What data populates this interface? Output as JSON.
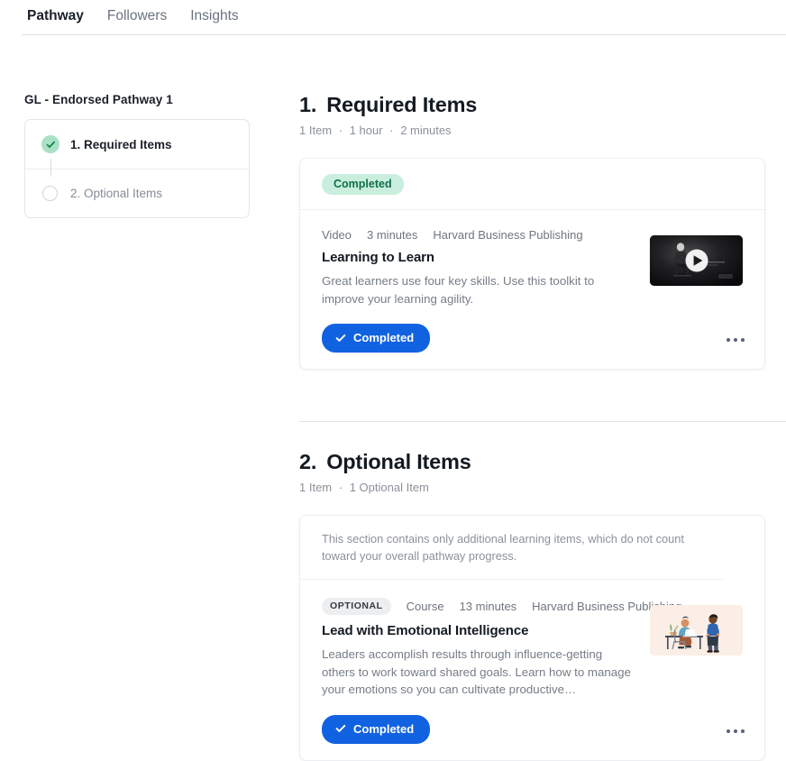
{
  "tabs": [
    {
      "label": "Pathway",
      "active": true
    },
    {
      "label": "Followers",
      "active": false
    },
    {
      "label": "Insights",
      "active": false
    }
  ],
  "sidebar": {
    "title": "GL - Endorsed Pathway 1",
    "items": [
      {
        "label": "1. Required Items",
        "state": "completed"
      },
      {
        "label": "2. Optional Items",
        "state": "todo"
      }
    ]
  },
  "sections": [
    {
      "number": "1.",
      "title": "Required Items",
      "meta": [
        "1 Item",
        "1 hour",
        "2 minutes"
      ],
      "banner_badge": "Completed",
      "note": null,
      "item": {
        "badge": null,
        "type": "Video",
        "duration": "3 minutes",
        "provider": "Harvard Business Publishing",
        "title": "Learning to Learn",
        "description": "Great learners use four key skills. Use this toolkit to improve your learning agility.",
        "button_label": "Completed",
        "thumbnail": "video-thumbnail"
      }
    },
    {
      "number": "2.",
      "title": "Optional Items",
      "meta": [
        "1 Item",
        "1 Optional Item"
      ],
      "banner_badge": null,
      "note": "This section contains only additional learning items, which do not count toward your overall pathway progress.",
      "item": {
        "badge": "OPTIONAL",
        "type": "Course",
        "duration": "13 minutes",
        "provider": "Harvard Business Publishing",
        "title": "Lead with Emotional Intelligence",
        "description": "Leaders accomplish results through influence-getting others to work toward shared goals. Learn how to manage your emotions so you can cultivate productive…",
        "button_label": "Completed",
        "thumbnail": "illustration-thumbnail"
      }
    }
  ],
  "colors": {
    "accent_blue": "#1162e0",
    "badge_green_bg": "#c9eedd",
    "badge_green_text": "#107048",
    "marker_green": "#a9e1c5",
    "badge_gray_bg": "#eceef0",
    "text_primary": "#141a21",
    "text_muted": "#8b9199"
  },
  "meta_separator": "·"
}
